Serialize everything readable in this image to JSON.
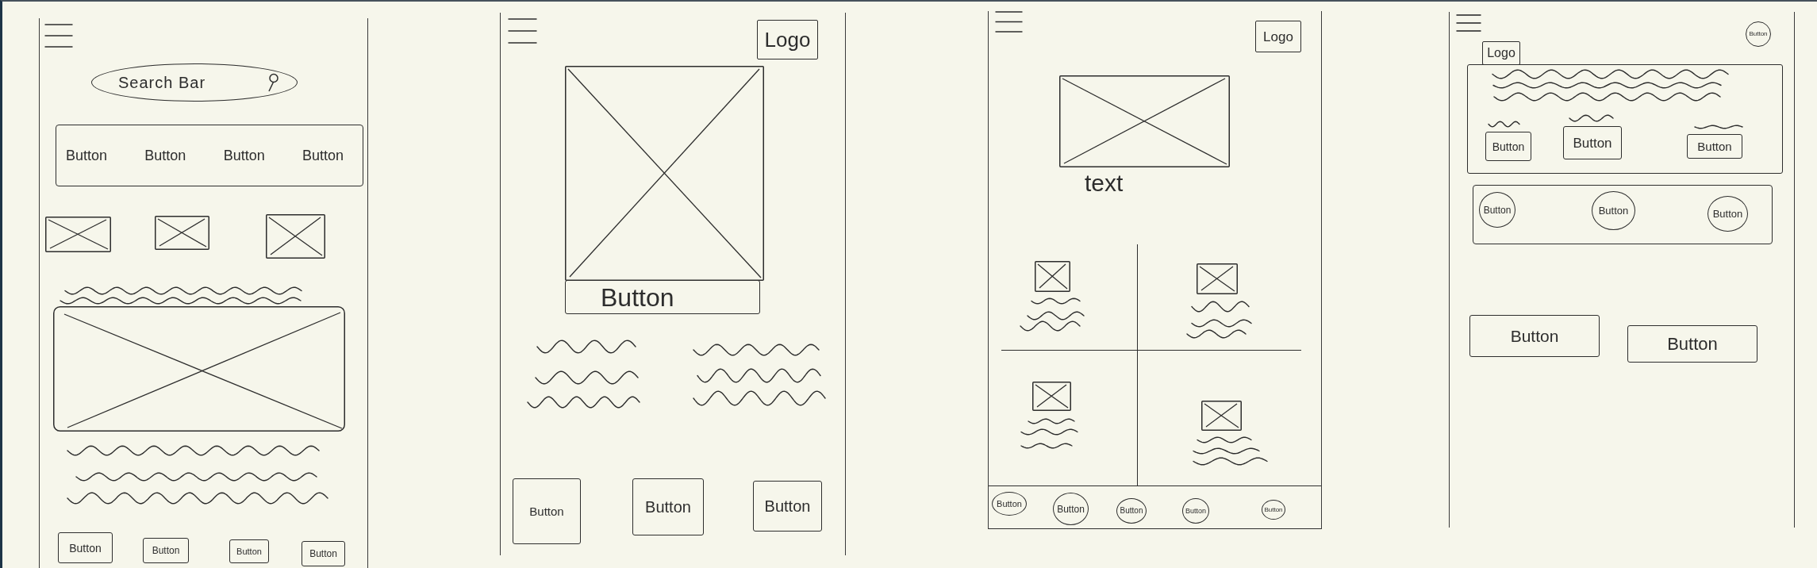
{
  "screens": [
    {
      "kind": "search_feed",
      "search": {
        "placeholder": "Search Bar"
      },
      "menu_buttons": [
        "Button",
        "Button",
        "Button",
        "Button"
      ],
      "footer_buttons": [
        "Button",
        "Button",
        "Button",
        "Button"
      ]
    },
    {
      "kind": "product_detail",
      "logo": "Logo",
      "hero_button": "Button",
      "footer_buttons": [
        "Button",
        "Button",
        "Button"
      ]
    },
    {
      "kind": "grid_list",
      "logo": "Logo",
      "caption": "text",
      "tab_buttons": [
        "Button",
        "Button",
        "Button",
        "Button",
        "Button"
      ]
    },
    {
      "kind": "profile",
      "corner_button": "Button",
      "logo": "Logo",
      "card_buttons": [
        "Button",
        "Button",
        "Button"
      ],
      "round_buttons": [
        "Button",
        "Button",
        "Button"
      ],
      "action_buttons": [
        "Button",
        "Button"
      ]
    }
  ]
}
